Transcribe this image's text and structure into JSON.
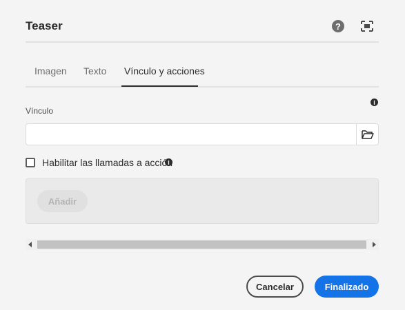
{
  "dialog": {
    "title": "Teaser",
    "help_icon": "help-icon",
    "fullscreen_icon": "fullscreen-icon"
  },
  "tabs": [
    {
      "label": "Imagen",
      "active": false
    },
    {
      "label": "Texto",
      "active": false
    },
    {
      "label": "Vínculo y acciones",
      "active": true
    }
  ],
  "link": {
    "label": "Vínculo",
    "value": "",
    "placeholder": "",
    "info_icon": "info-icon",
    "browse_icon": "folder-icon"
  },
  "cta": {
    "checkbox_label": "Habilitar las llamadas a acción",
    "checked": false,
    "info_icon": "info-icon",
    "add_label": "Añadir"
  },
  "footer": {
    "cancel_label": "Cancelar",
    "done_label": "Finalizado"
  },
  "colors": {
    "accent": "#1473e6",
    "background": "#f4f4f4"
  }
}
